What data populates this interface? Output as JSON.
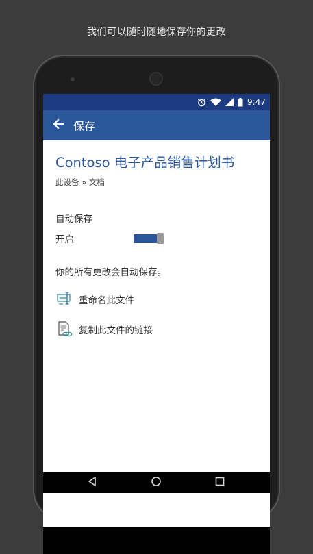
{
  "caption": "我们可以随时随地保存你的更改",
  "statusbar": {
    "time": "9:47"
  },
  "appbar": {
    "title": "保存"
  },
  "document": {
    "title": "Contoso 电子产品销售计划书",
    "breadcrumb": "此设备 » 文档"
  },
  "autosave": {
    "section_label": "自动保存",
    "toggle_label": "开启",
    "enabled": true,
    "note": "你的所有更改会自动保存。"
  },
  "actions": [
    {
      "label": "重命名此文件",
      "icon": "rename-icon"
    },
    {
      "label": "复制此文件的链接",
      "icon": "copy-link-icon"
    }
  ],
  "navigation": [
    "back-triangle-icon",
    "home-circle-icon",
    "recents-square-icon"
  ],
  "colors": {
    "accent": "#2b579a",
    "statusbar": "#1c3b80",
    "background": "#3c3c3c"
  }
}
